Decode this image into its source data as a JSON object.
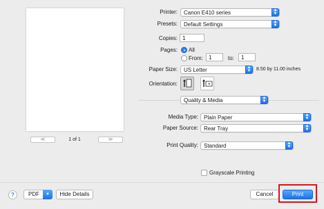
{
  "preview": {
    "page_indicator": "1 of 1"
  },
  "printer": {
    "label": "Printer:",
    "value": "Canon E410 series"
  },
  "presets": {
    "label": "Presets:",
    "value": "Default Settings"
  },
  "copies": {
    "label": "Copies:",
    "value": "1"
  },
  "pages": {
    "label": "Pages:",
    "all_label": "All",
    "from_label": "From:",
    "from_value": "1",
    "to_label": "to:",
    "to_value": "1",
    "selected": "All"
  },
  "paper_size": {
    "label": "Paper Size:",
    "value": "US Letter",
    "dimensions": "8.50 by 11.00 inches"
  },
  "orientation": {
    "label": "Orientation:",
    "selected": "portrait"
  },
  "section": {
    "value": "Quality & Media"
  },
  "media_type": {
    "label": "Media Type:",
    "value": "Plain Paper"
  },
  "paper_source": {
    "label": "Paper Source:",
    "value": "Rear Tray"
  },
  "print_quality": {
    "label": "Print Quality:",
    "value": "Standard"
  },
  "grayscale": {
    "label": "Grayscale Printing",
    "checked": false
  },
  "footer": {
    "help": "?",
    "pdf_label": "PDF",
    "hide_details_label": "Hide Details",
    "cancel_label": "Cancel",
    "print_label": "Print"
  },
  "colors": {
    "accent": "#2a83f0",
    "highlight_box": "#d8141e"
  }
}
